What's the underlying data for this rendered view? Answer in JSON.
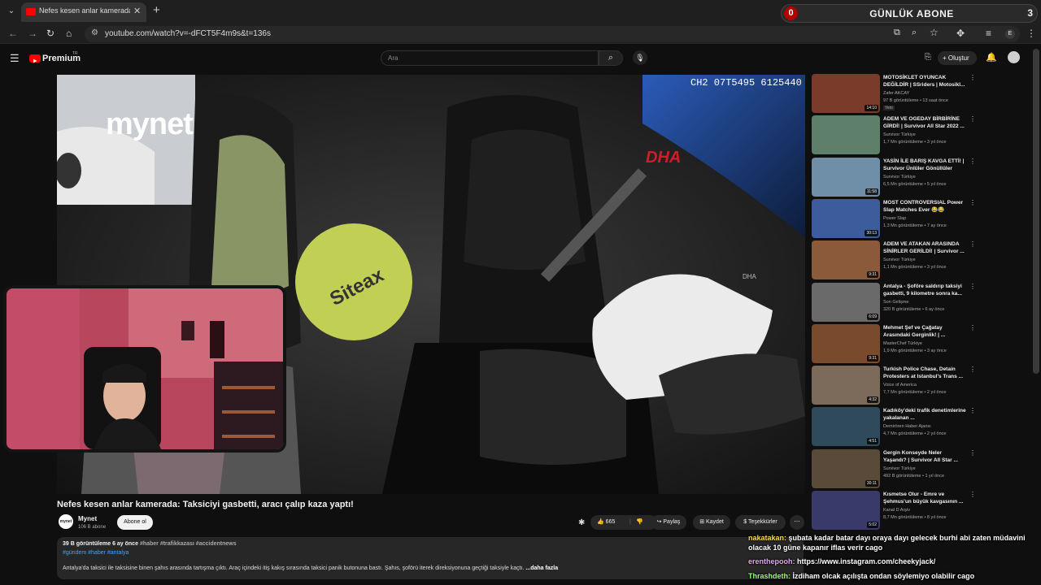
{
  "browser": {
    "tab_title": "Nefes kesen anlar kamerada: Ta",
    "url": "youtube.com/watch?v=-dFCT5F4m9s&t=136s"
  },
  "stream_overlay": {
    "left_count": "0",
    "title": "GÜNLÜK ABONE",
    "right_count": "3"
  },
  "youtube": {
    "logo": "Premium",
    "logo_region": "TR",
    "search_placeholder": "Ara",
    "create_label": "Oluştur"
  },
  "video": {
    "osd": "CH2 07T5495 6125440",
    "watermark": "mynet",
    "agency": "DHA",
    "agency_vertical": "DHA"
  },
  "details": {
    "title": "Nefes kesen anlar kamerada: Taksiciyi gasbetti, aracı çalıp kaza yaptı!",
    "channel": "Mynet",
    "subscribers": "106 B abone",
    "subscribe_label": "Abone ol",
    "likes": "665",
    "share_label": "Paylaş",
    "save_label": "Kaydet",
    "thanks_label": "Teşekkürler",
    "meta": "39 B görüntüleme  6 ay önce",
    "meta_tags": "#haber #trafikkazası #accidentnews",
    "tags": "#gündem #haber #antalya",
    "text": "Antalya'da taksici ile taksisine binen şahıs arasında tartışma çıktı. Araç içindeki itiş kakış sırasında taksici panik butonuna bastı. Şahıs, şoförü iterek direksiyonuna geçtiği taksiyle kaçtı.",
    "more": "...daha fazla"
  },
  "recommendations": [
    {
      "title": "MOTOSİKLET OYUNCAK DEĞİLDİR | SSriders | Motosikl...",
      "channel": "Zafer AKCAY",
      "meta": "97 B görüntüleme • 13 saat önce",
      "badge": "Yeni",
      "duration": "14:10",
      "color": "#7a3b2a"
    },
    {
      "title": "ADEM VE OGEDAY BİRBİRİNE GİRDİ! | Survivor All Star 2022 ...",
      "channel": "Survivor Türkiye",
      "meta": "1,7 Mn görüntüleme • 3 yıl önce",
      "badge": "",
      "duration": "",
      "color": "#5e7f6a"
    },
    {
      "title": "YASİN İLE BARIŞ KAVGA ETTİ! | Survivor Ünlüler Gönüllüler",
      "channel": "Survivor Türkiye",
      "meta": "6,5 Mn görüntüleme • 5 yıl önce",
      "badge": "",
      "duration": "11:58",
      "color": "#6f8fa8"
    },
    {
      "title": "MOST CONTROVERSIAL Power Slap Matches Ever 😂😂",
      "channel": "Power Slap",
      "meta": "1,3 Mn görüntüleme • 7 ay önce",
      "badge": "",
      "duration": "30:13",
      "color": "#3d5c9c"
    },
    {
      "title": "ADEM VE ATAKAN ARASINDA SİNİRLER GERİLDİ! | Survivor ...",
      "channel": "Survivor Türkiye",
      "meta": "1,1 Mn görüntüleme • 3 yıl önce",
      "badge": "",
      "duration": "9:31",
      "color": "#8a5a3a"
    },
    {
      "title": "Antalya - Şoföre saldırıp taksiyi gasbetti, 9 kilometre sonra ka...",
      "channel": "Son Gelişme",
      "meta": "320 B görüntüleme • 6 ay önce",
      "badge": "",
      "duration": "6:09",
      "color": "#6a6a6a"
    },
    {
      "title": "Mehmet Şef ve Çağatay Arasındaki Gerginlik! | ...",
      "channel": "MasterChef Türkiye",
      "meta": "1,9 Mn görüntüleme • 3 ay önce",
      "badge": "",
      "duration": "9:31",
      "color": "#7a4a2c"
    },
    {
      "title": "Turkish Police Chase, Detain Protesters at Istanbul's Trans ...",
      "channel": "Voice of America",
      "meta": "7,7 Mn görüntüleme • 2 yıl önce",
      "badge": "",
      "duration": "4:32",
      "color": "#7c6a5a"
    },
    {
      "title": "Kadıköy'deki trafik denetimlerine yakalanan ...",
      "channel": "Demirören Haber Ajansı",
      "meta": "4,7 Mn görüntüleme • 2 yıl önce",
      "badge": "",
      "duration": "4:51",
      "color": "#2f4a5a"
    },
    {
      "title": "Gergin Konseyde Neler Yaşandı? | Survivor All Star ...",
      "channel": "Survivor Türkiye",
      "meta": "492 B görüntüleme • 1 yıl önce",
      "badge": "",
      "duration": "30:11",
      "color": "#5a4a3a"
    },
    {
      "title": "Kısmetse Olur - Emre ve Şehmus'un büyük kavgasının ...",
      "channel": "Kanal D Arşiv",
      "meta": "8,7 Mn görüntüleme • 8 yıl önce",
      "badge": "",
      "duration": "5:02",
      "color": "#3a3a6a"
    }
  ],
  "chat": [
    {
      "user": "nakatakan:",
      "text": "şubata kadar batar dayı oraya dayı gelecek burhi abi zaten müdavini olacak 10 güne kapanır iflas verir cago",
      "color": "#ffd84a"
    },
    {
      "user": "erenthepooh:",
      "text": "https://www.instagram.com/cheekyjack/",
      "color": "#e5a6ff"
    },
    {
      "user": "Thrashdeth:",
      "text": "İzdiham olcak açılışta ondan söylemiyo olabilir cago",
      "color": "#9cff7a"
    }
  ]
}
